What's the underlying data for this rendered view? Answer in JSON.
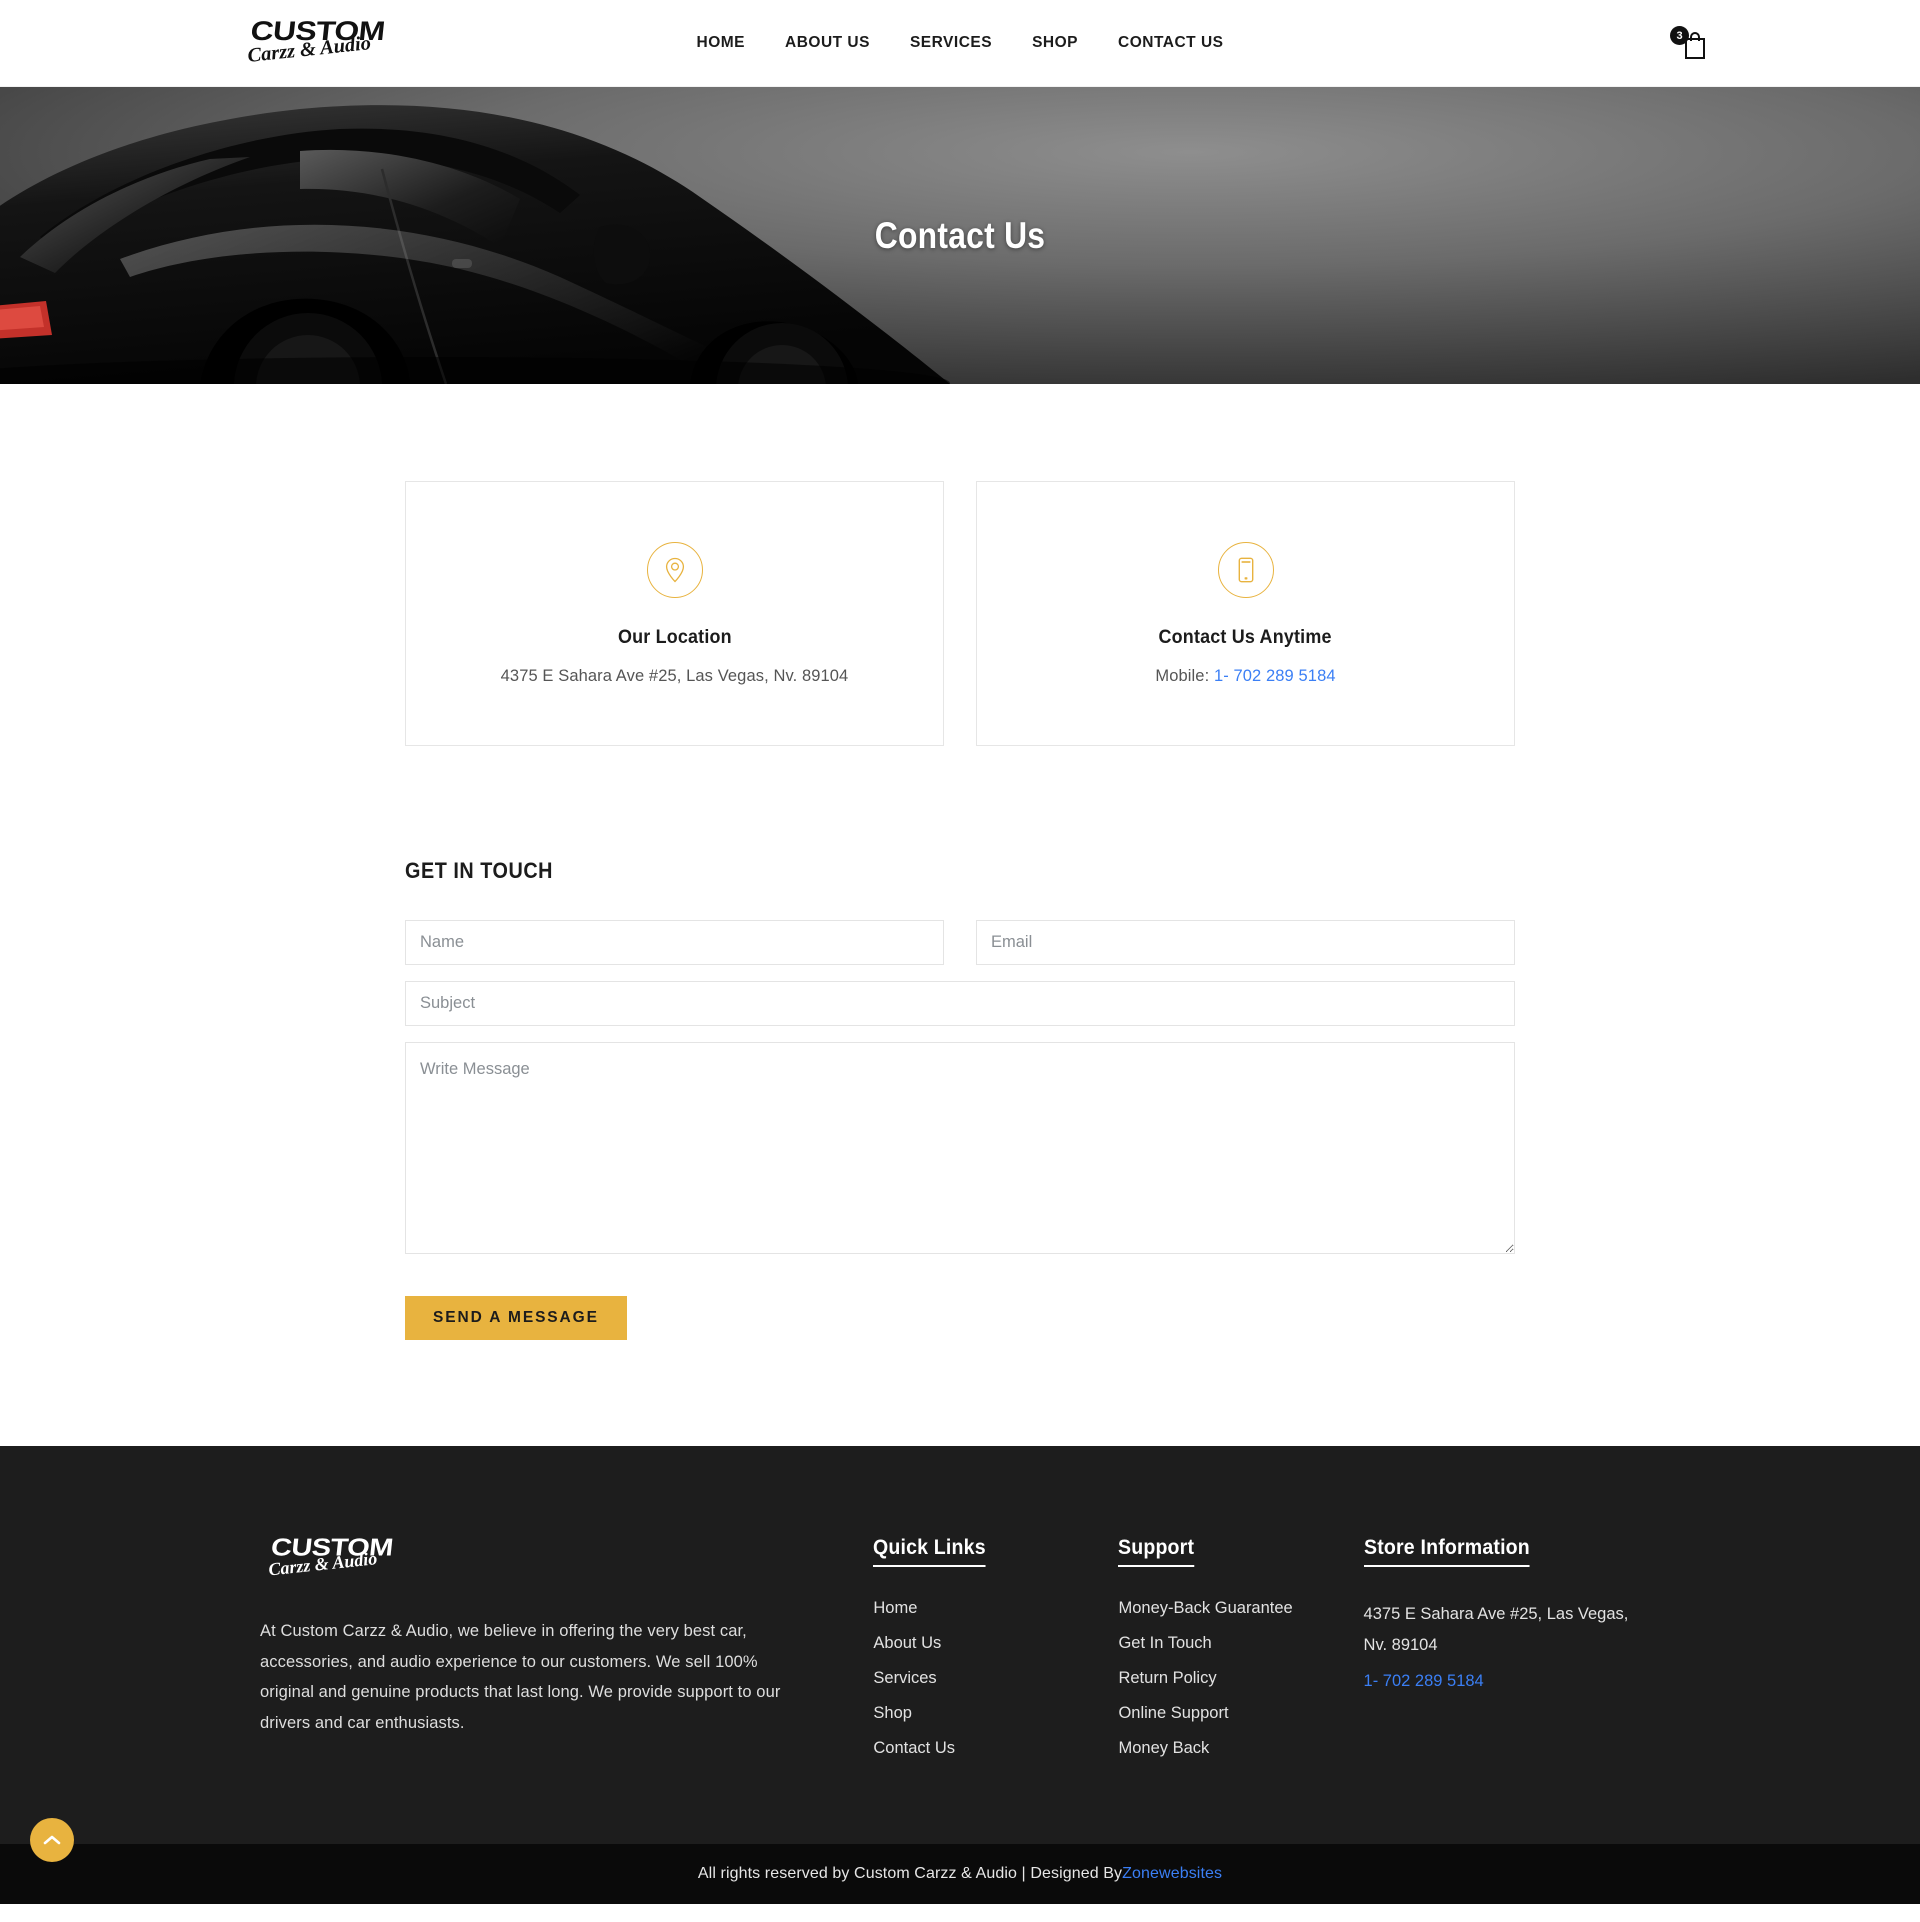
{
  "header": {
    "logo": {
      "line1": "CUSTOM",
      "line2": "Carzz & Audio"
    },
    "nav": [
      {
        "label": "HOME"
      },
      {
        "label": "ABOUT US"
      },
      {
        "label": "SERVICES"
      },
      {
        "label": "SHOP"
      },
      {
        "label": "CONTACT US"
      }
    ],
    "cart": {
      "count": "3",
      "icon": "shopping-bag-icon"
    }
  },
  "hero": {
    "title": "Contact Us"
  },
  "cards": [
    {
      "icon": "map-pin-icon",
      "title": "Our Location",
      "text": "4375 E Sahara Ave #25, Las Vegas, Nv. 89104"
    },
    {
      "icon": "mobile-phone-icon",
      "title": "Contact Us Anytime",
      "prefix": "Mobile: ",
      "phone": "1- 702 289 5184"
    }
  ],
  "form": {
    "heading": "GET IN TOUCH",
    "name_placeholder": "Name",
    "email_placeholder": "Email",
    "subject_placeholder": "Subject",
    "message_placeholder": "Write Message",
    "submit_label": "SEND A MESSAGE"
  },
  "footer": {
    "logo": {
      "line1": "CUSTOM",
      "line2": "Carzz & Audio"
    },
    "description": "At Custom Carzz & Audio, we believe in offering the very best car, accessories, and audio experience to our customers. We sell 100% original and genuine products that last long. We provide support to our drivers and car enthusiasts.",
    "quick_links": {
      "heading": "Quick Links",
      "items": [
        {
          "label": "Home"
        },
        {
          "label": "About Us"
        },
        {
          "label": "Services"
        },
        {
          "label": "Shop"
        },
        {
          "label": "Contact Us"
        }
      ]
    },
    "support": {
      "heading": "Support",
      "items": [
        {
          "label": "Money-Back Guarantee"
        },
        {
          "label": "Get In Touch"
        },
        {
          "label": "Return Policy"
        },
        {
          "label": "Online Support"
        },
        {
          "label": "Money Back"
        }
      ]
    },
    "store": {
      "heading": "Store Information",
      "address": "4375 E Sahara Ave #25, Las Vegas, Nv. 89104",
      "phone": "1- 702 289 5184"
    }
  },
  "copyright": {
    "text": "All rights reserved by Custom Carzz & Audio | Designed By ",
    "designer": "Zonewebsites"
  },
  "scroll_top": {
    "icon": "chevron-up-icon"
  },
  "colors": {
    "accent": "#e8b33f",
    "link": "#3b7ff5",
    "footer_bg": "#1d1d1d",
    "copyright_bg": "#0a0a0a",
    "text_dark": "#1c1c1c"
  }
}
